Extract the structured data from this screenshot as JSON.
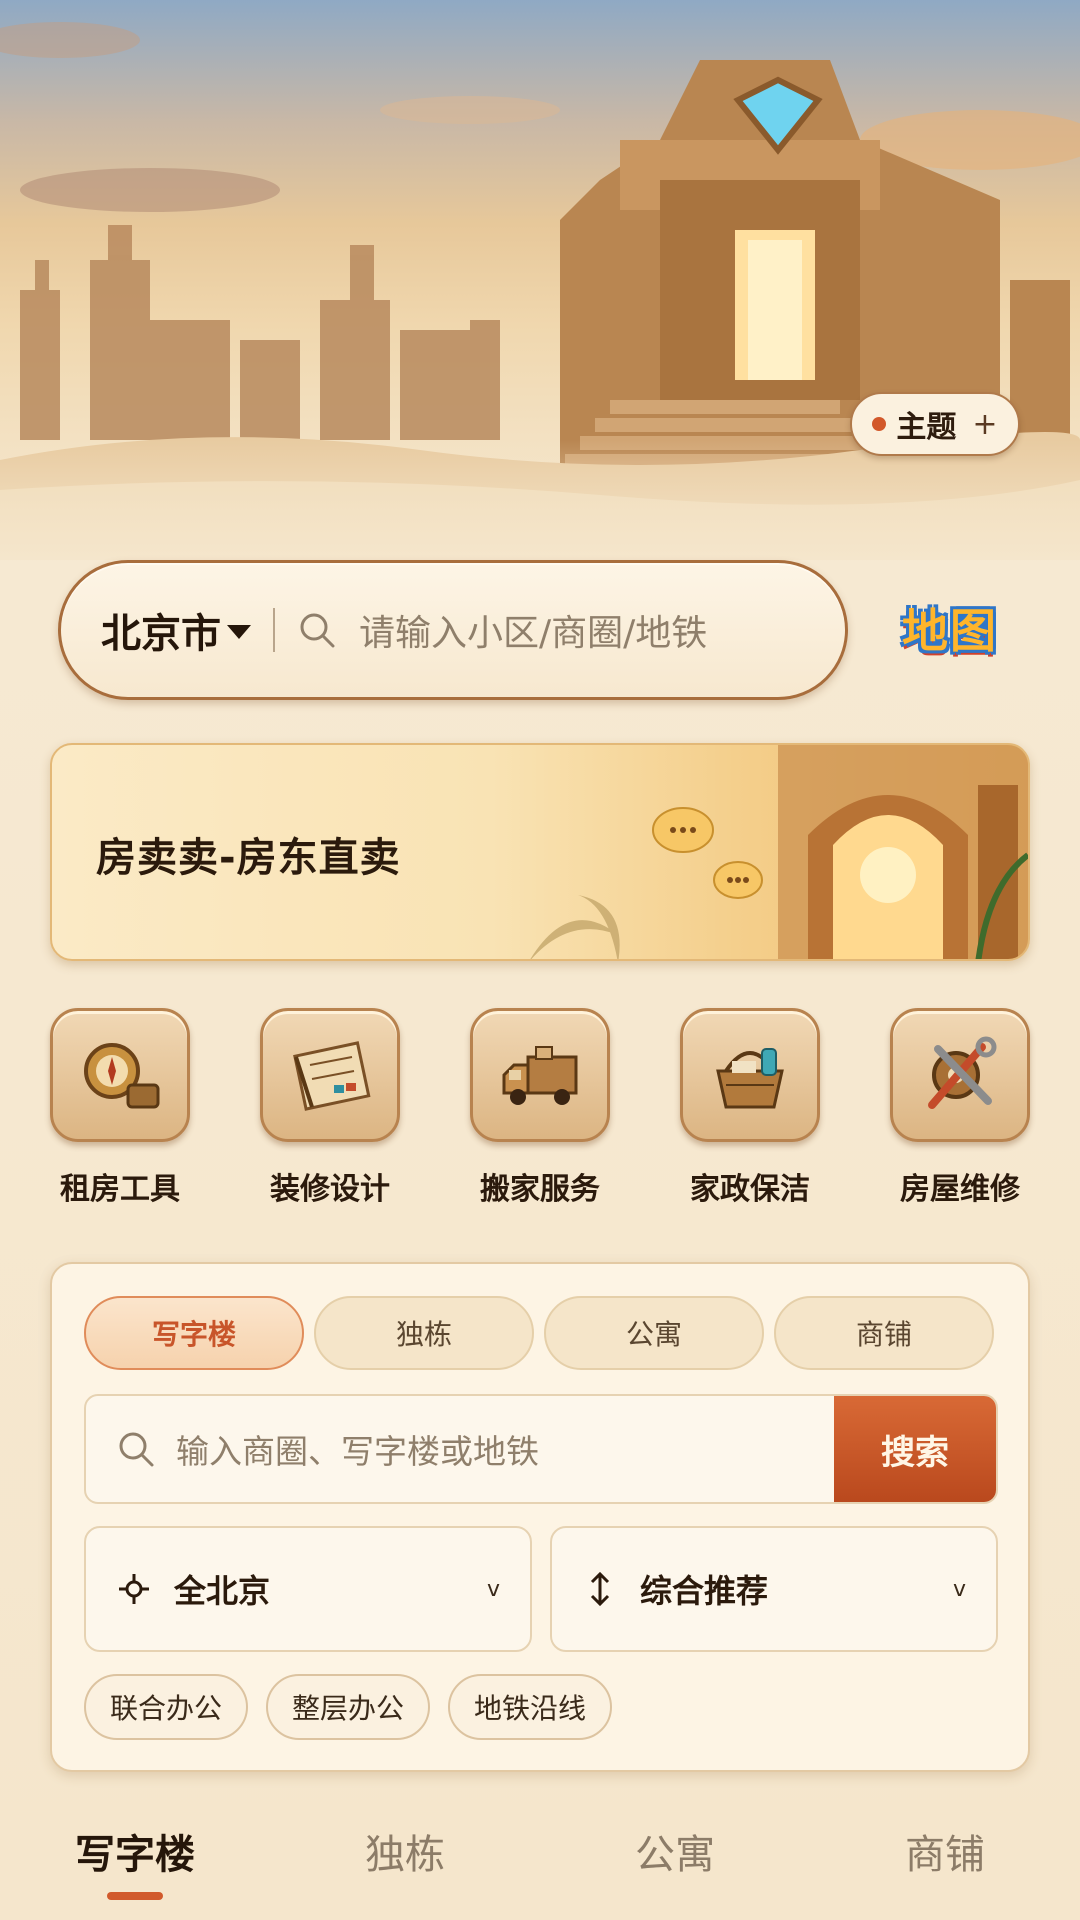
{
  "hero": {
    "theme_label": "主题",
    "theme_plus": "+"
  },
  "top_search": {
    "city": "北京市",
    "placeholder": "请输入小区/商圈/地铁",
    "map_label": "地图"
  },
  "banner": {
    "title": "房卖卖-房东直卖"
  },
  "services": [
    {
      "label": "租房工具",
      "icon": "compass-tools-icon"
    },
    {
      "label": "装修设计",
      "icon": "blueprint-icon"
    },
    {
      "label": "搬家服务",
      "icon": "moving-truck-icon"
    },
    {
      "label": "家政保洁",
      "icon": "cleaning-basket-icon"
    },
    {
      "label": "房屋维修",
      "icon": "repair-tools-icon"
    }
  ],
  "filter": {
    "segments": [
      "写字楼",
      "独栋",
      "公寓",
      "商铺"
    ],
    "active_segment": "写字楼",
    "search_placeholder": "输入商圈、写字楼或地铁",
    "search_button": "搜索",
    "region": "全北京",
    "sort": "综合推荐",
    "caret": "v",
    "chips": [
      "联合办公",
      "整层办公",
      "地铁沿线"
    ]
  },
  "tabs": [
    {
      "label": "写字楼",
      "active": true
    },
    {
      "label": "独栋",
      "active": false
    },
    {
      "label": "公寓",
      "active": false
    },
    {
      "label": "商铺",
      "active": false
    }
  ],
  "colors": {
    "accent": "#d15a2c",
    "background": "#f5e6cc",
    "border": "#a86d3c"
  }
}
